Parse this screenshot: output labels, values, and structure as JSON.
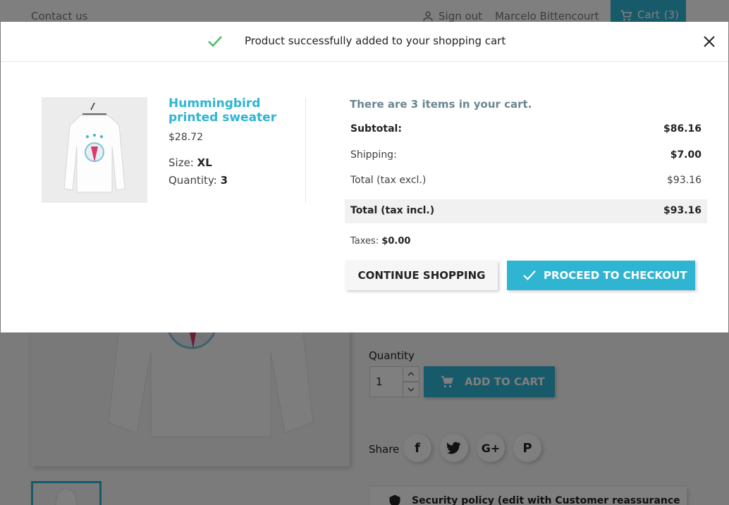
{
  "header": {
    "contact_label": "Contact us",
    "signout_label": "Sign out",
    "user_name": "Marcelo Bittencourt",
    "cart_label": "Cart",
    "cart_count": "(3)"
  },
  "modal": {
    "title": "Product successfully added to your shopping cart",
    "product": {
      "name": "Hummingbird printed sweater",
      "price": "$28.72",
      "size_label": "Size:",
      "size_value": "XL",
      "quantity_label": "Quantity:",
      "quantity_value": "3"
    },
    "summary": {
      "items_text": "There are 3 items in your cart.",
      "subtotal_label": "Subtotal:",
      "subtotal_value": "$86.16",
      "shipping_label": "Shipping:",
      "shipping_value": "$7.00",
      "total_excl_label": "Total (tax excl.)",
      "total_excl_value": "$93.16",
      "total_incl_label": "Total (tax incl.)",
      "total_incl_value": "$93.16",
      "taxes_label": "Taxes:",
      "taxes_value": "$0.00"
    },
    "continue_label": "CONTINUE SHOPPING",
    "checkout_label": "PROCEED TO CHECKOUT"
  },
  "page": {
    "quantity_label": "Quantity",
    "quantity_value": "1",
    "add_to_cart_label": "ADD TO CART",
    "share_label": "Share",
    "security_text": "Security policy (edit with Customer reassurance"
  },
  "colors": {
    "accent": "#2fb5d2",
    "success": "#4cbb6c",
    "muted_heading": "#6b8691"
  },
  "icons": [
    "person-icon",
    "cart-icon",
    "check-icon",
    "close-icon",
    "facebook-icon",
    "twitter-icon",
    "googleplus-icon",
    "pinterest-icon",
    "shield-icon"
  ]
}
